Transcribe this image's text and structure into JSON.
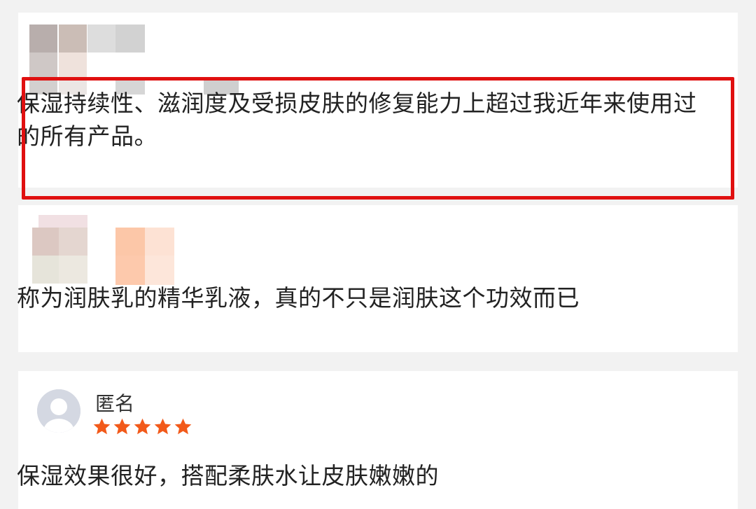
{
  "reviews": [
    {
      "text": "保湿持续性、滋润度及受损皮肤的修复能力上超过我近年来使用过的所有产品。",
      "highlighted": true
    },
    {
      "text": "称为润肤乳的精华乳液，真的不只是润肤这个功效而已",
      "highlighted": false
    },
    {
      "username": "匿名",
      "rating": 5,
      "text": "保湿效果很好，搭配柔肤水让皮肤嫩嫩的",
      "highlighted": false
    }
  ],
  "colors": {
    "highlight": "#e01010",
    "star": "#f25a1a",
    "background": "#f2f2f2"
  },
  "icons": {
    "avatar": "default-user-icon",
    "star": "star-icon"
  }
}
